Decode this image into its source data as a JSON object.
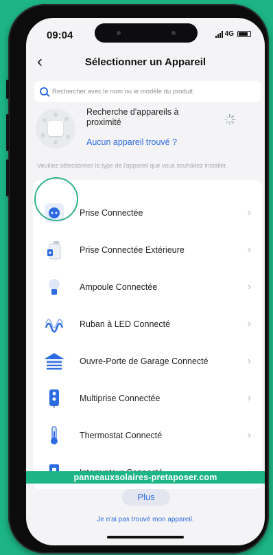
{
  "status": {
    "time": "09:04",
    "network": "4G"
  },
  "nav": {
    "back": "‹",
    "title": "Sélectionner un Appareil"
  },
  "search": {
    "placeholder": "Rechercher avec le nom ou le modèle du produit."
  },
  "nearby": {
    "title": "Recherche d'appareils à proximité",
    "link": "Aucun appareil trouvé ?"
  },
  "hint": "Veuillez sélectionner le type de l'appareil que vous souhaitez installer.",
  "devices": [
    {
      "label": "Prise Connectée",
      "icon": "plug-icon"
    },
    {
      "label": "Prise Connectée Extérieure",
      "icon": "outdoor-plug-icon"
    },
    {
      "label": "Ampoule Connectée",
      "icon": "bulb-icon"
    },
    {
      "label": "Ruban à LED Connecté",
      "icon": "led-strip-icon"
    },
    {
      "label": "Ouvre-Porte de Garage Connecté",
      "icon": "garage-icon"
    },
    {
      "label": "Multiprise Connectée",
      "icon": "power-strip-icon"
    },
    {
      "label": "Thermostat Connecté",
      "icon": "thermostat-icon"
    },
    {
      "label": "Interrupteur Connecté",
      "icon": "switch-icon"
    }
  ],
  "chevron": "›",
  "watermark": "panneauxsolaires-pretaposer.com",
  "plus_button": "Plus",
  "not_found": "Je n'ai pas trouvé mon appareil.",
  "colors": {
    "accent": "#2d6be0",
    "brand_green": "#1db585",
    "highlight_ring": "#2fb08a"
  }
}
